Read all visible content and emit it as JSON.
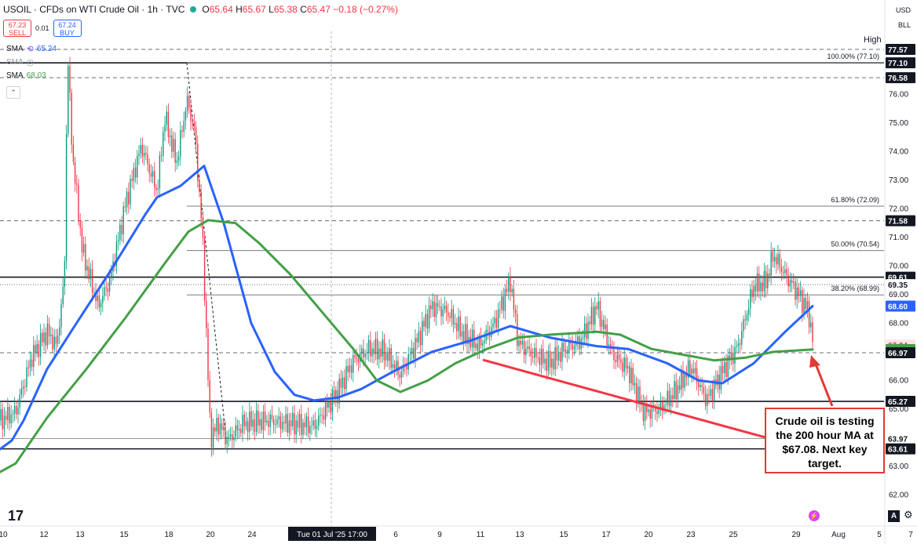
{
  "header": {
    "symbol": "USOIL · CFDs on WTI Crude Oil · 1h · TVC",
    "o_label": "O",
    "o": "65.64",
    "h_label": "H",
    "h": "65.67",
    "l_label": "L",
    "l": "65.38",
    "c_label": "C",
    "c": "65.47",
    "change": "−0.18 (−0.27%)"
  },
  "trade": {
    "sell_price": "67.23",
    "sell_label": "SELL",
    "spread": "0.01",
    "buy_price": "67.24",
    "buy_label": "BUY"
  },
  "indicators": [
    {
      "name": "SMA",
      "value": "65.24",
      "color": "#2962ff"
    },
    {
      "name": "SMA",
      "value": "",
      "color": "#9598a1"
    },
    {
      "name": "SMA",
      "value": "68.03",
      "color": "#43a047"
    }
  ],
  "currency": "USD",
  "unit": "BLL",
  "high_label": "High",
  "annotation": "Crude oil is testing the 200 hour MA at $67.08. Next key target.",
  "chart_data": {
    "type": "line",
    "title": "USOIL · CFDs on WTI Crude Oil · 1h · TVC",
    "ylim": [
      61.6,
      78.2
    ],
    "y_ticks": [
      "62.00",
      "63.00",
      "64.00",
      "65.00",
      "66.00",
      "67.00",
      "68.00",
      "69.00",
      "70.00",
      "71.00",
      "72.00",
      "73.00",
      "74.00",
      "75.00",
      "76.00",
      "77.00"
    ],
    "x_ticks": [
      "10",
      "12",
      "13",
      "15",
      "18",
      "20",
      "24",
      "26",
      "Tue 01 Jul '25  17:00",
      "6",
      "9",
      "11",
      "13",
      "15",
      "17",
      "20",
      "23",
      "25",
      "29",
      "Aug",
      "5",
      "7"
    ],
    "price_labels": [
      {
        "label": "77.57",
        "value": 77.57,
        "color": "#131722"
      },
      {
        "label": "77.10",
        "value": 77.1,
        "color": "#131722"
      },
      {
        "label": "76.58",
        "value": 76.58,
        "color": "#131722"
      },
      {
        "label": "71.58",
        "value": 71.58,
        "color": "#131722"
      },
      {
        "label": "69.61",
        "value": 69.61,
        "color": "#131722"
      },
      {
        "label": "69.35",
        "value": 69.35,
        "color": "#131722"
      },
      {
        "label": "68.60",
        "value": 68.6,
        "color": "#2962ff"
      },
      {
        "label": "67.24",
        "value": 67.24,
        "color": "#f23645"
      },
      {
        "label": "67.08",
        "value": 67.08,
        "color": "#43a047"
      },
      {
        "label": "66.97",
        "value": 66.97,
        "color": "#131722"
      },
      {
        "label": "65.27",
        "value": 65.27,
        "color": "#131722"
      },
      {
        "label": "63.97",
        "value": 63.97,
        "color": "#ffffff"
      },
      {
        "label": "63.61",
        "value": 63.61,
        "color": "#131722"
      }
    ],
    "fib_levels": [
      {
        "label": "100.00% (77.10)",
        "value": 77.1
      },
      {
        "label": "61.80% (72.09)",
        "value": 72.09
      },
      {
        "label": "50.00% (70.54)",
        "value": 70.54
      },
      {
        "label": "38.20% (68.99)",
        "value": 68.99
      }
    ],
    "horizontal_lines": [
      {
        "value": 77.1,
        "style": "solid"
      },
      {
        "value": 77.57,
        "style": "dashed"
      },
      {
        "value": 76.58,
        "style": "dashed"
      },
      {
        "value": 71.58,
        "style": "dashed"
      },
      {
        "value": 69.61,
        "style": "solid"
      },
      {
        "value": 69.35,
        "style": "dotted"
      },
      {
        "value": 66.97,
        "style": "dashed"
      },
      {
        "value": 65.27,
        "style": "solid"
      },
      {
        "value": 63.97,
        "style": "thin"
      },
      {
        "value": 63.61,
        "style": "solid"
      }
    ],
    "series": [
      {
        "name": "SMA",
        "color": "#2962ff",
        "points": [
          [
            0,
            63.6
          ],
          [
            15,
            63.9
          ],
          [
            30,
            64.6
          ],
          [
            60,
            66.4
          ],
          [
            95,
            67.9
          ],
          [
            140,
            69.8
          ],
          [
            185,
            71.8
          ],
          [
            200,
            72.4
          ],
          [
            230,
            72.8
          ],
          [
            260,
            73.5
          ],
          [
            285,
            71.5
          ],
          [
            320,
            68.0
          ],
          [
            350,
            66.3
          ],
          [
            375,
            65.5
          ],
          [
            400,
            65.3
          ],
          [
            430,
            65.4
          ],
          [
            460,
            65.7
          ],
          [
            500,
            66.3
          ],
          [
            550,
            67.0
          ],
          [
            600,
            67.4
          ],
          [
            650,
            67.9
          ],
          [
            700,
            67.5
          ],
          [
            760,
            67.2
          ],
          [
            800,
            67.1
          ],
          [
            850,
            66.6
          ],
          [
            890,
            66.0
          ],
          [
            920,
            65.9
          ],
          [
            960,
            66.6
          ],
          [
            1000,
            67.7
          ],
          [
            1035,
            68.6
          ]
        ]
      },
      {
        "name": "SMA",
        "color": "#43a047",
        "points": [
          [
            0,
            62.8
          ],
          [
            20,
            63.1
          ],
          [
            60,
            64.7
          ],
          [
            110,
            66.4
          ],
          [
            160,
            68.2
          ],
          [
            210,
            70.1
          ],
          [
            240,
            71.2
          ],
          [
            265,
            71.6
          ],
          [
            300,
            71.5
          ],
          [
            330,
            70.8
          ],
          [
            370,
            69.7
          ],
          [
            410,
            68.4
          ],
          [
            450,
            67.1
          ],
          [
            480,
            66.0
          ],
          [
            510,
            65.6
          ],
          [
            545,
            66.0
          ],
          [
            580,
            66.6
          ],
          [
            620,
            67.1
          ],
          [
            660,
            67.5
          ],
          [
            700,
            67.6
          ],
          [
            760,
            67.7
          ],
          [
            790,
            67.6
          ],
          [
            830,
            67.1
          ],
          [
            870,
            66.9
          ],
          [
            910,
            66.7
          ],
          [
            950,
            66.8
          ],
          [
            985,
            67.0
          ],
          [
            1035,
            67.08
          ]
        ]
      },
      {
        "name": "",
        "color": "#f23645",
        "marker": "candles",
        "points": [
          [
            0,
            64.6
          ],
          [
            20,
            64.9
          ],
          [
            40,
            66.8
          ],
          [
            60,
            67.7
          ],
          [
            72,
            67.2
          ],
          [
            82,
            69.5
          ],
          [
            86,
            77.5
          ],
          [
            92,
            74.0
          ],
          [
            105,
            70.5
          ],
          [
            125,
            68.6
          ],
          [
            140,
            69.5
          ],
          [
            160,
            72.2
          ],
          [
            180,
            74.2
          ],
          [
            200,
            72.6
          ],
          [
            210,
            75.2
          ],
          [
            225,
            73.6
          ],
          [
            238,
            75.8
          ],
          [
            248,
            74.7
          ],
          [
            258,
            71.0
          ],
          [
            268,
            64.0
          ],
          [
            278,
            64.5
          ],
          [
            290,
            63.9
          ],
          [
            310,
            64.5
          ],
          [
            340,
            64.6
          ],
          [
            370,
            64.5
          ],
          [
            400,
            64.4
          ],
          [
            430,
            65.6
          ],
          [
            450,
            66.7
          ],
          [
            470,
            67.1
          ],
          [
            490,
            67.0
          ],
          [
            510,
            66.2
          ],
          [
            530,
            67.3
          ],
          [
            550,
            68.6
          ],
          [
            570,
            68.4
          ],
          [
            590,
            67.6
          ],
          [
            610,
            67.2
          ],
          [
            630,
            68.0
          ],
          [
            650,
            69.5
          ],
          [
            660,
            67.3
          ],
          [
            680,
            66.9
          ],
          [
            700,
            66.6
          ],
          [
            720,
            67.1
          ],
          [
            740,
            67.4
          ],
          [
            760,
            68.6
          ],
          [
            780,
            66.9
          ],
          [
            800,
            66.4
          ],
          [
            820,
            64.9
          ],
          [
            840,
            65.0
          ],
          [
            860,
            65.6
          ],
          [
            880,
            66.5
          ],
          [
            900,
            65.3
          ],
          [
            920,
            66.3
          ],
          [
            940,
            67.2
          ],
          [
            960,
            69.3
          ],
          [
            975,
            69.4
          ],
          [
            985,
            70.4
          ],
          [
            1000,
            69.7
          ],
          [
            1015,
            69.1
          ],
          [
            1030,
            68.4
          ],
          [
            1037,
            67.0
          ]
        ]
      }
    ],
    "trendline": {
      "from": [
        615,
        66.72
      ],
      "to": [
        1125,
        62.88
      ],
      "color": "#f23645"
    },
    "retrace_dashed": {
      "from": [
        238,
        77.1
      ],
      "to": [
        288,
        63.97
      ]
    }
  }
}
